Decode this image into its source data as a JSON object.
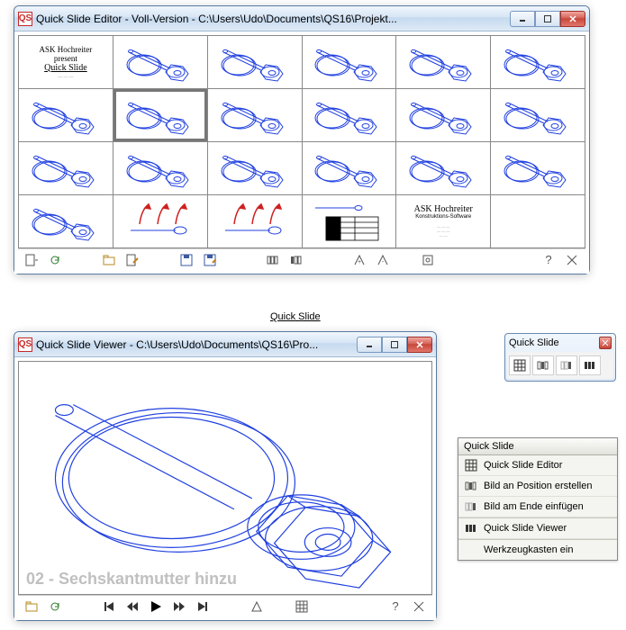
{
  "editor": {
    "title": "Quick Slide Editor - Voll-Version - C:\\Users\\Udo\\Documents\\QS16\\Projekt...",
    "selected_index": 7,
    "cells": [
      {
        "kind": "title",
        "line1": "ASK Hochreiter",
        "line2": "present",
        "line3": "Quick Slide"
      },
      {
        "kind": "bolt"
      },
      {
        "kind": "bolt"
      },
      {
        "kind": "bolt"
      },
      {
        "kind": "bolt"
      },
      {
        "kind": "bolt"
      },
      {
        "kind": "bolt"
      },
      {
        "kind": "bolt"
      },
      {
        "kind": "bolt"
      },
      {
        "kind": "bolt"
      },
      {
        "kind": "bolt"
      },
      {
        "kind": "bolt"
      },
      {
        "kind": "bolt"
      },
      {
        "kind": "bolt"
      },
      {
        "kind": "bolt"
      },
      {
        "kind": "bolt"
      },
      {
        "kind": "bolt"
      },
      {
        "kind": "bolt"
      },
      {
        "kind": "bolt"
      },
      {
        "kind": "arrows"
      },
      {
        "kind": "arrows"
      },
      {
        "kind": "table"
      },
      {
        "kind": "credits",
        "line1": "ASK Hochreiter",
        "line2": "Konstruktions-Software"
      },
      {
        "kind": "blank"
      }
    ]
  },
  "label_between": "Quick Slide",
  "viewer": {
    "title": "Quick Slide Viewer - C:\\Users\\Udo\\Documents\\QS16\\Pro...",
    "caption": "02 - Sechskantmutter hinzu"
  },
  "toolbox": {
    "title": "Quick Slide"
  },
  "palette": {
    "title": "Quick Slide",
    "items": [
      {
        "label": "Quick Slide Editor",
        "icon": "grid"
      },
      {
        "label": "Bild an Position erstellen",
        "icon": "insert-pos"
      },
      {
        "label": "Bild am Ende einfügen",
        "icon": "insert-end"
      },
      {
        "label": "Quick Slide Viewer",
        "icon": "viewer"
      },
      {
        "label": "Werkzeugkasten ein",
        "icon": "none"
      }
    ]
  }
}
